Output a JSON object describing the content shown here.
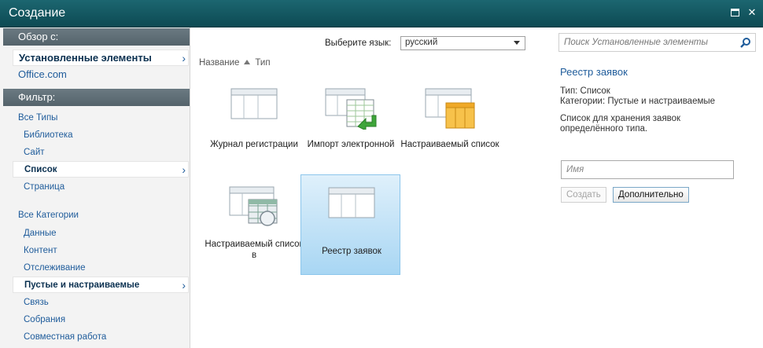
{
  "window": {
    "title": "Создание"
  },
  "leftnav": {
    "browse_header": "Обзор с:",
    "browse_items": [
      {
        "label": "Установленные элементы",
        "selected": true
      },
      {
        "label": "Office.com",
        "selected": false
      }
    ],
    "filter_header": "Фильтр:",
    "types_label": "Все Типы",
    "types": [
      {
        "label": "Библиотека"
      },
      {
        "label": "Сайт"
      },
      {
        "label": "Список",
        "selected": true
      },
      {
        "label": "Страница"
      }
    ],
    "categories_label": "Все Категории",
    "categories": [
      {
        "label": "Данные"
      },
      {
        "label": "Контент"
      },
      {
        "label": "Отслеживание"
      },
      {
        "label": "Пустые и настраиваемые",
        "selected": true
      },
      {
        "label": "Связь"
      },
      {
        "label": "Собрания"
      },
      {
        "label": "Совместная работа"
      }
    ]
  },
  "main": {
    "language_label": "Выберите язык:",
    "language_value": "русский",
    "sort": {
      "name": "Название",
      "type": "Тип"
    },
    "tiles": [
      {
        "label": "Журнал регистрации",
        "icon": "list-icon"
      },
      {
        "label": "Импорт электронной",
        "icon": "import-spreadsheet-icon"
      },
      {
        "label": "Настраиваемый список",
        "icon": "custom-list-icon"
      },
      {
        "label": "Настраиваемый список в",
        "icon": "datasheet-list-icon"
      },
      {
        "label": "Реестр заявок",
        "icon": "list-icon",
        "selected": true
      }
    ]
  },
  "details": {
    "search_placeholder": "Поиск Установленные элементы",
    "title": "Реестр заявок",
    "type_line": "Тип: Список",
    "category_line": "Категории: Пустые и настраиваемые",
    "description": [
      "Список для хранения заявок",
      "определённого типа."
    ],
    "name_placeholder": "Имя",
    "create_label": "Создать",
    "more_label": "Дополнительно"
  },
  "colors": {
    "titlebar": "#0d4a53",
    "nav_header": "#5e6c74",
    "link": "#1f5c9b",
    "tile_selected": "#a8d6f3"
  }
}
